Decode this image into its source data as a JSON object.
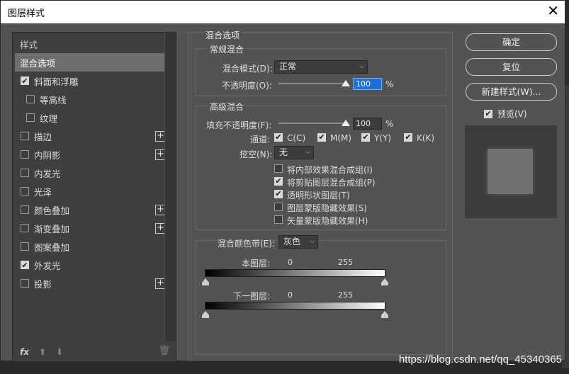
{
  "dialog": {
    "title": "图层样式"
  },
  "sidebar": {
    "header": "样式",
    "selected": "混合选项",
    "items": [
      {
        "label": "斜面和浮雕",
        "checked": true,
        "plus": false,
        "sub": false
      },
      {
        "label": "等高线",
        "checked": false,
        "plus": false,
        "sub": true
      },
      {
        "label": "纹理",
        "checked": false,
        "plus": false,
        "sub": true
      },
      {
        "label": "描边",
        "checked": false,
        "plus": true,
        "sub": false
      },
      {
        "label": "内阴影",
        "checked": false,
        "plus": true,
        "sub": false
      },
      {
        "label": "内发光",
        "checked": false,
        "plus": false,
        "sub": false
      },
      {
        "label": "光泽",
        "checked": false,
        "plus": false,
        "sub": false
      },
      {
        "label": "颜色叠加",
        "checked": false,
        "plus": true,
        "sub": false
      },
      {
        "label": "渐变叠加",
        "checked": false,
        "plus": true,
        "sub": false
      },
      {
        "label": "图案叠加",
        "checked": false,
        "plus": false,
        "sub": false
      },
      {
        "label": "外发光",
        "checked": true,
        "plus": false,
        "sub": false
      },
      {
        "label": "投影",
        "checked": false,
        "plus": true,
        "sub": false
      }
    ],
    "fx_label": "fx"
  },
  "panel": {
    "title": "混合选项",
    "general": {
      "title": "常规混合",
      "blend_mode_label": "混合模式(D):",
      "blend_mode_value": "正常",
      "opacity_label": "不透明度(O):",
      "opacity_value": "100",
      "opacity_unit": "%"
    },
    "advanced": {
      "title": "高级混合",
      "fill_label": "填充不透明度(F):",
      "fill_value": "100",
      "fill_unit": "%",
      "channels_label": "通道:",
      "channels": [
        "C(C)",
        "M(M)",
        "Y(Y)",
        "K(K)"
      ],
      "knockout_label": "挖空(N):",
      "knockout_value": "无",
      "options": [
        {
          "label": "将内部效果混合成组(I)",
          "checked": false
        },
        {
          "label": "将剪贴图层混合成组(P)",
          "checked": true
        },
        {
          "label": "透明形状图层(T)",
          "checked": true
        },
        {
          "label": "图层蒙版隐藏效果(S)",
          "checked": false
        },
        {
          "label": "矢量蒙版隐藏效果(H)",
          "checked": false
        }
      ]
    },
    "blend_if": {
      "label": "混合颜色带(E):",
      "value": "灰色",
      "this_layer_label": "本图层:",
      "this_layer_min": "0",
      "this_layer_max": "255",
      "under_layer_label": "下一图层:",
      "under_layer_min": "0",
      "under_layer_max": "255"
    }
  },
  "buttons": {
    "ok": "确定",
    "reset": "复位",
    "new_style": "新建样式(W)...",
    "preview_label": "预览(V)",
    "preview_checked": true
  },
  "watermark": "https://blog.csdn.net/qq_45340365"
}
